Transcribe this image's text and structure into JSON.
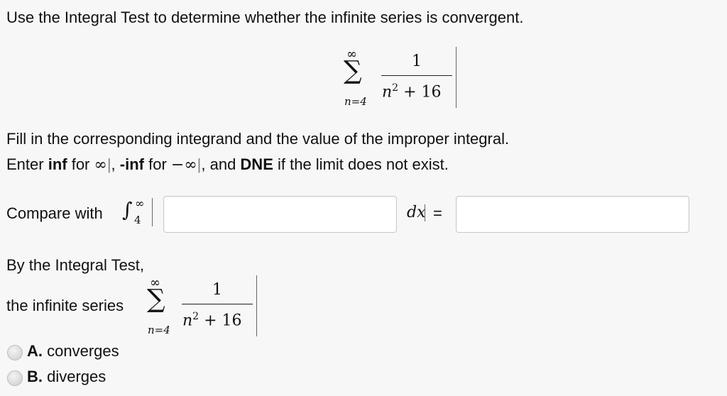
{
  "question": {
    "prompt": "Use the Integral Test to determine whether the infinite series is convergent.",
    "series": {
      "upper": "∞",
      "sigma": "∑",
      "lower": "n=4",
      "numerator": "1",
      "denominator_var": "n",
      "denominator_exp": "2",
      "denominator_rest": "+ 16"
    },
    "instructions": {
      "line1": "Fill in the corresponding integrand and the value of the improper integral.",
      "line2_parts": [
        "Enter ",
        "inf",
        " for ",
        "∞",
        ", ",
        "-inf",
        " for ",
        "−∞",
        ", and ",
        "DNE",
        " if the limit does not exist."
      ]
    },
    "compare": {
      "label": "Compare with",
      "integral_sign": "∫",
      "upper": "∞",
      "lower": "4",
      "integrand_value": "",
      "dx": "dx",
      "equals": "=",
      "result_value": ""
    },
    "by_test": "By the Integral Test,",
    "infinite_series_label": "the infinite series",
    "options": [
      {
        "letter": "A.",
        "text": "converges"
      },
      {
        "letter": "B.",
        "text": "diverges"
      }
    ]
  }
}
